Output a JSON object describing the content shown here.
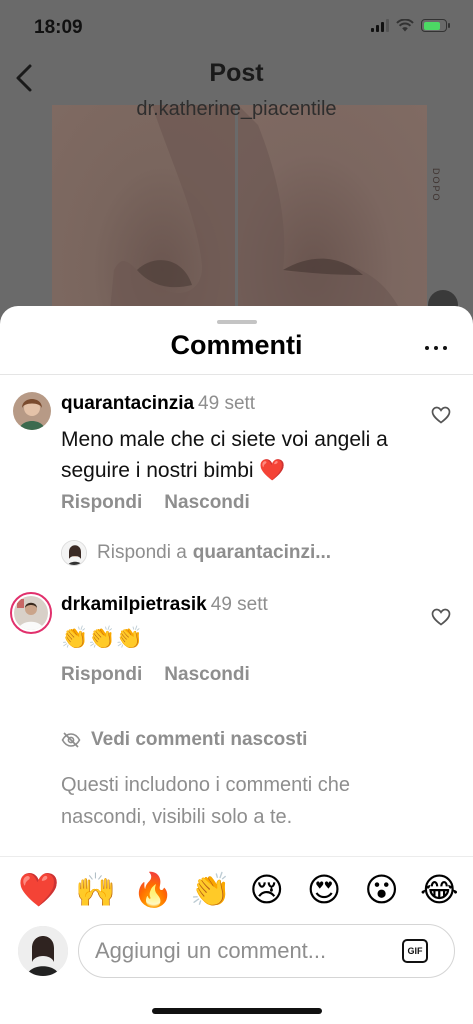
{
  "status_bar": {
    "time": "18:09"
  },
  "post_header": {
    "title": "Post",
    "username": "dr.katherine_piacentile",
    "photo_tag": "DOPO"
  },
  "sheet": {
    "title": "Commenti"
  },
  "comments": [
    {
      "username": "quarantacinzia",
      "time": "49 sett",
      "text": "Meno male che ci siete voi angeli a seguire i nostri bimbi ❤️",
      "reply_label": "Rispondi",
      "hide_label": "Nascondi"
    },
    {
      "username": "drkamilpietrasik",
      "time": "49 sett",
      "text": "👏👏👏",
      "reply_label": "Rispondi",
      "hide_label": "Nascondi"
    }
  ],
  "reply_to": {
    "prefix": "Rispondi a",
    "target": "quarantacinzi..."
  },
  "hidden_comments": {
    "link": "Vedi commenti nascosti",
    "note": "Questi includono i commenti che nascondi, visibili solo a te."
  },
  "emoji_bar": [
    "❤️",
    "🙌",
    "🔥",
    "👏",
    "😢",
    "😍",
    "😮",
    "😂"
  ],
  "composer": {
    "placeholder": "Aggiungi un comment...",
    "gif_label": "GIF"
  },
  "colors": {
    "secondary_text": "#8e8e8e",
    "dim_overlay": "#6a6a6a",
    "battery": "#4cd964"
  }
}
